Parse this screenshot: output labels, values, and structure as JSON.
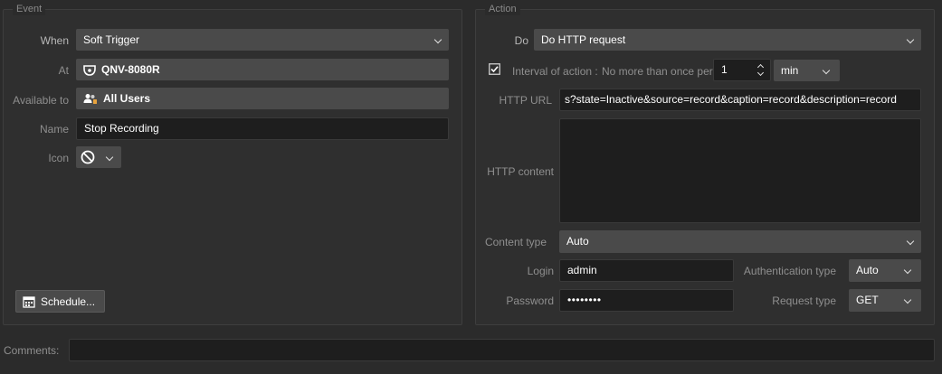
{
  "event": {
    "title": "Event",
    "when_label": "When",
    "when_value": "Soft Trigger",
    "at_label": "At",
    "at_value": "QNV-8080R",
    "available_label": "Available to",
    "available_value": "All Users",
    "name_label": "Name",
    "name_value": "Stop Recording",
    "icon_label": "Icon",
    "schedule_label": "Schedule..."
  },
  "action": {
    "title": "Action",
    "do_label": "Do",
    "do_value": "Do HTTP request",
    "interval_label": "Interval of action :",
    "interval_desc": "No more than once per",
    "interval_checked": true,
    "interval_value": "1",
    "interval_unit": "min",
    "url_label": "HTTP URL",
    "url_value": "s?state=Inactive&source=record&caption=record&description=record",
    "content_label": "HTTP content",
    "content_value": "",
    "content_type_label": "Content type",
    "content_type_value": "Auto",
    "login_label": "Login",
    "login_value": "admin",
    "password_label": "Password",
    "password_value": "••••••••",
    "auth_label": "Authentication type",
    "auth_value": "Auto",
    "request_label": "Request type",
    "request_value": "GET"
  },
  "comments": {
    "label": "Comments:",
    "value": ""
  },
  "colors": {
    "accent": "#e8a33d",
    "background": "#2b2b2b",
    "field": "#4a4a4a",
    "field_dark": "#1e1e1e"
  },
  "icons": {
    "at": "camera-icon",
    "available": "users-icon",
    "icon_value": "prohibited-icon",
    "schedule": "calendar-icon",
    "interval_checkbox": "checkmark-icon"
  }
}
